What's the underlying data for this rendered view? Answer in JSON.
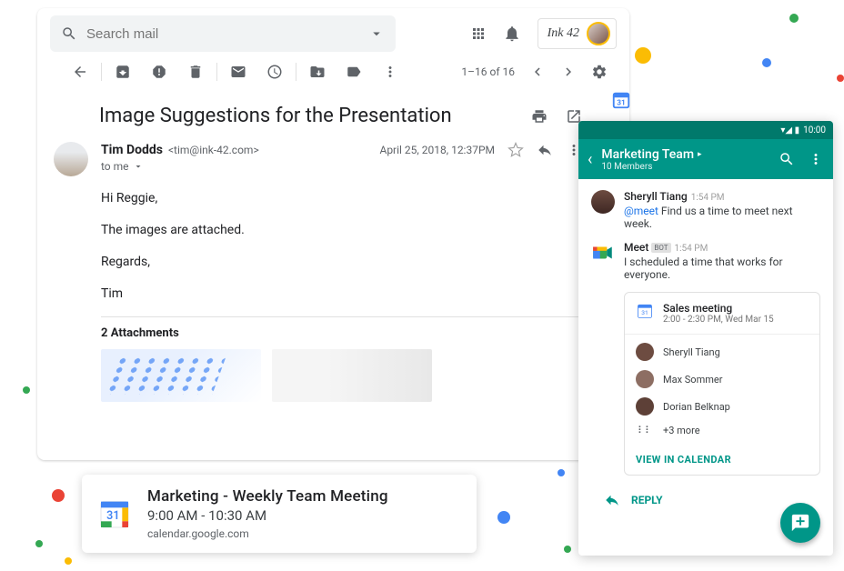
{
  "decorative_dots": true,
  "gmail": {
    "search_placeholder": "Search mail",
    "brand": "Ink 42",
    "pagination": "1–16 of 16",
    "subject": "Image Suggestions for the Presentation",
    "sender_name": "Tim Dodds",
    "sender_email": "<tim@ink-42.com>",
    "timestamp": "April 25, 2018, 12:37PM",
    "to_line": "to me",
    "body_line1": "Hi Reggie,",
    "body_line2": "The images are attached.",
    "body_line3": "Regards,",
    "body_line4": "Tim",
    "attachments_label": "2 Attachments"
  },
  "notification": {
    "title": "Marketing - Weekly Team Meeting",
    "time": "9:00 AM - 10:30 AM",
    "source": "calendar.google.com"
  },
  "mobile": {
    "status_time": "10:00",
    "room_name": "Marketing Team",
    "room_members": "10 Members",
    "msg1_name": "Sheryll Tiang",
    "msg1_time": "1:54 PM",
    "msg1_mention": "@meet",
    "msg1_text": " Find us a time to meet next week.",
    "msg2_name": "Meet",
    "msg2_badge": "BOT",
    "msg2_time": "1:54 PM",
    "msg2_text": "I scheduled a time that works for everyone.",
    "event_title": "Sales meeting",
    "event_time": "2:00 - 2:30 PM, Wed Mar 15",
    "attendees": {
      "a1": "Sheryll Tiang",
      "a2": "Max Sommer",
      "a3": "Dorian Belknap",
      "more": "+3 more"
    },
    "view_label": "VIEW IN CALENDAR",
    "reply_label": "REPLY"
  }
}
